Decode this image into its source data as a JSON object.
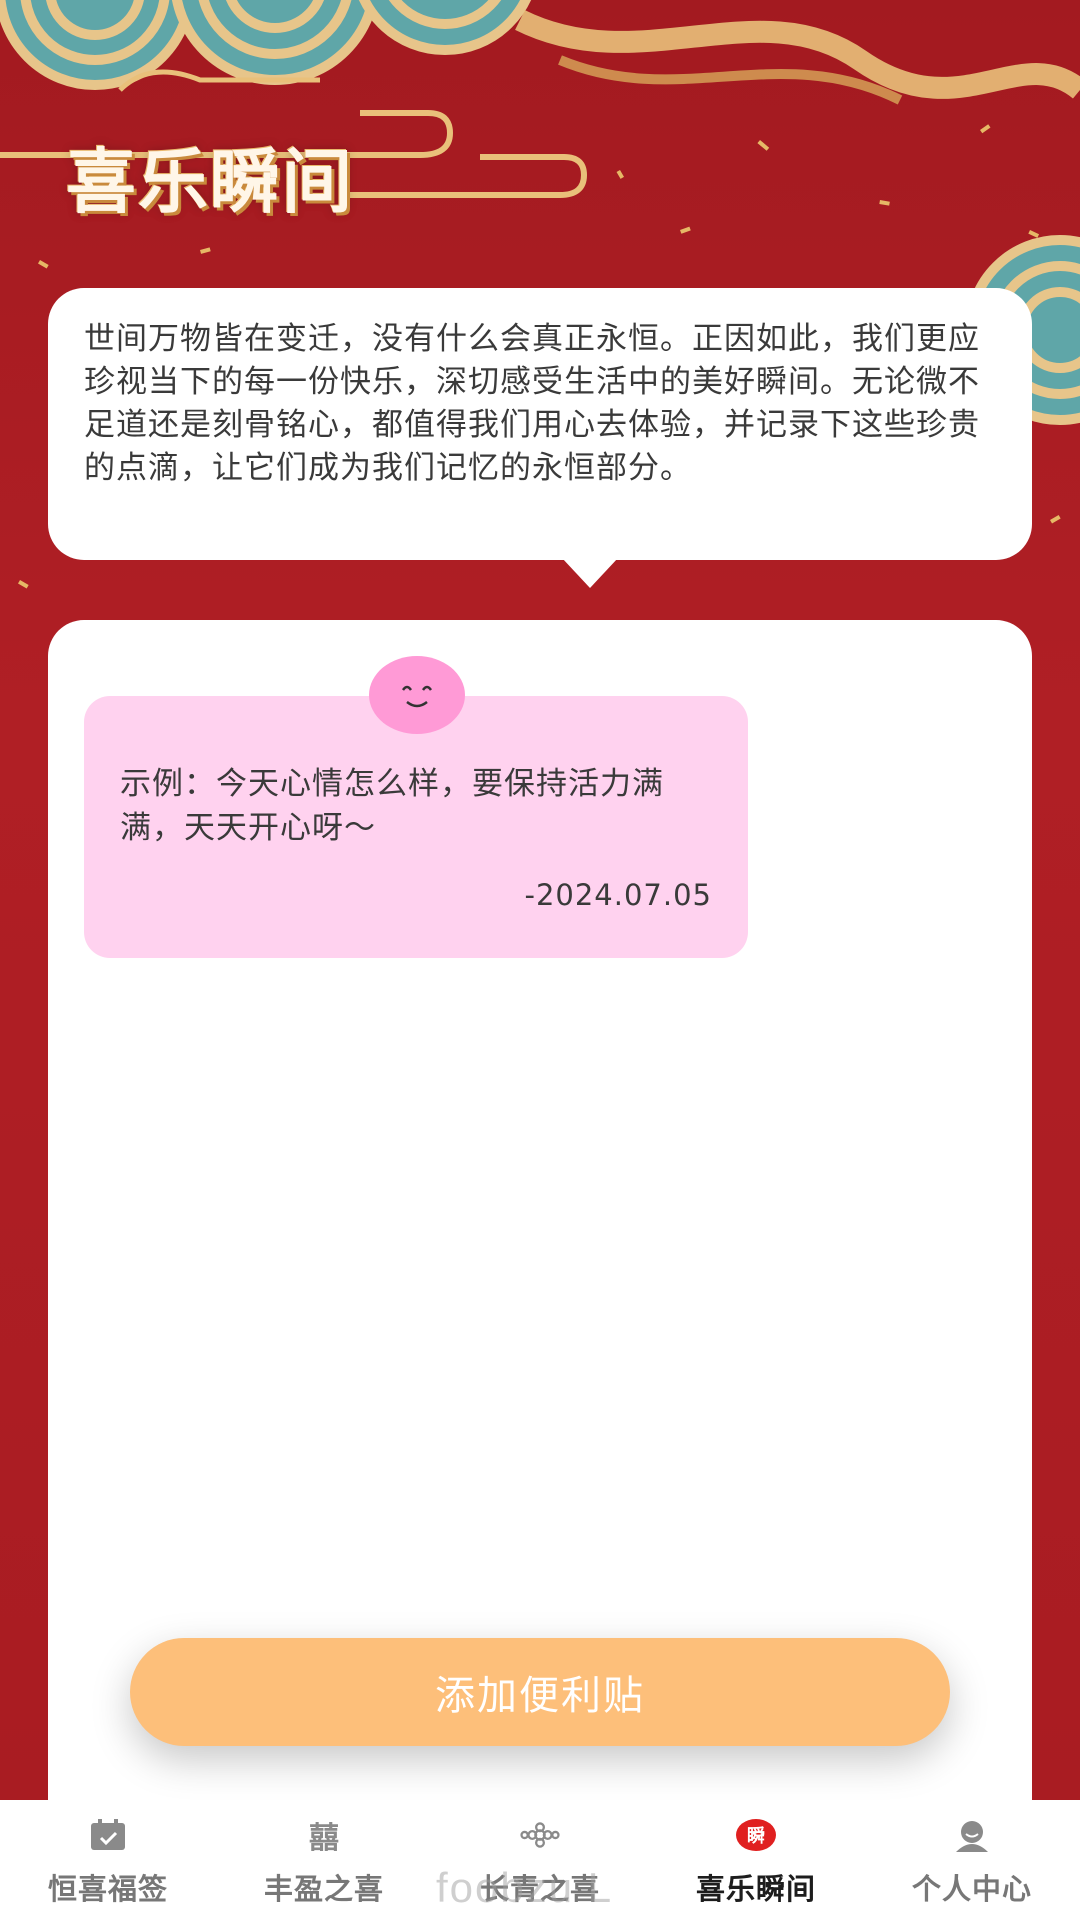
{
  "header": {
    "title": "喜乐瞬间"
  },
  "intro": {
    "text": "世间万物皆在变迁，没有什么会真正永恒。正因如此，我们更应珍视当下的每一份快乐，深切感受生活中的美好瞬间。无论微不足道还是刻骨铭心，都值得我们用心去体验，并记录下这些珍贵的点滴，让它们成为我们记忆的永恒部分。"
  },
  "notes": [
    {
      "icon": "smile-face-icon",
      "text": "示例：今天心情怎么样，要保持活力满满，天天开心呀～",
      "date": "-2024.07.05",
      "color": "#ffd2ef"
    }
  ],
  "add_button": {
    "label": "添加便利贴",
    "color": "#fdbf7a"
  },
  "tabbar": {
    "items": [
      {
        "label": "恒喜福签",
        "icon": "calendar-check-icon",
        "active": false
      },
      {
        "label": "丰盈之喜",
        "icon": "double-happiness-icon",
        "active": false
      },
      {
        "label": "长青之喜",
        "icon": "chinese-knot-icon",
        "active": false
      },
      {
        "label": "喜乐瞬间",
        "icon": "moment-badge-icon",
        "active": true
      },
      {
        "label": "个人中心",
        "icon": "user-avatar-icon",
        "active": false
      }
    ],
    "active_color": "#e02020"
  },
  "watermark": "foobzu L",
  "theme": {
    "background": "#a81d22",
    "accent_gold": "#e9b86b",
    "teal": "#5fa6a8"
  }
}
